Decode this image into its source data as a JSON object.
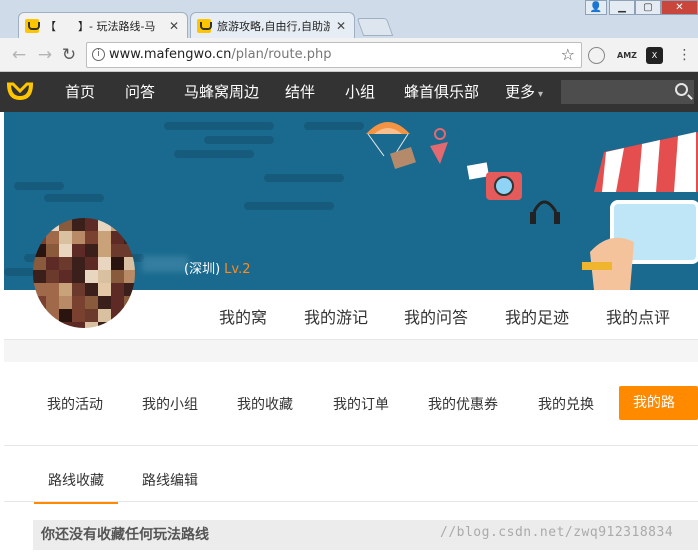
{
  "browser": {
    "tabs": [
      {
        "label": "【　　】- 玩法路线-马",
        "active": true
      },
      {
        "label": "旅游攻略,自由行,自助游",
        "active": false
      }
    ],
    "url_host": "www.mafengwo.cn",
    "url_path": "/plan/route.php",
    "ext_amz": "AMZ",
    "ext_x": "X"
  },
  "nav": {
    "items": [
      "首页",
      "问答",
      "马蜂窝周边",
      "结伴",
      "小组",
      "蜂首俱乐部",
      "更多"
    ],
    "more_arrow": "▾"
  },
  "profile": {
    "city": "(深圳)",
    "level": "Lv.2"
  },
  "profile_tabs": [
    "我的窝",
    "我的游记",
    "我的问答",
    "我的足迹",
    "我的点评"
  ],
  "center_menu": [
    "我的活动",
    "我的小组",
    "我的收藏",
    "我的订单",
    "我的优惠券",
    "我的兑换",
    "我的路线"
  ],
  "route_tabs": [
    "路线收藏",
    "路线编辑"
  ],
  "empty_message": "你还没有收藏任何玩法路线",
  "watermark": "//blog.csdn.net/zwq912318834",
  "colors": {
    "accent": "#ff8a00",
    "nav_bg": "#333333",
    "banner_bg": "#1a6a8f"
  },
  "icons": [
    "mafengwo-logo-icon",
    "back-icon",
    "forward-icon",
    "reload-icon",
    "info-icon",
    "star-icon",
    "search-icon",
    "close-icon"
  ]
}
